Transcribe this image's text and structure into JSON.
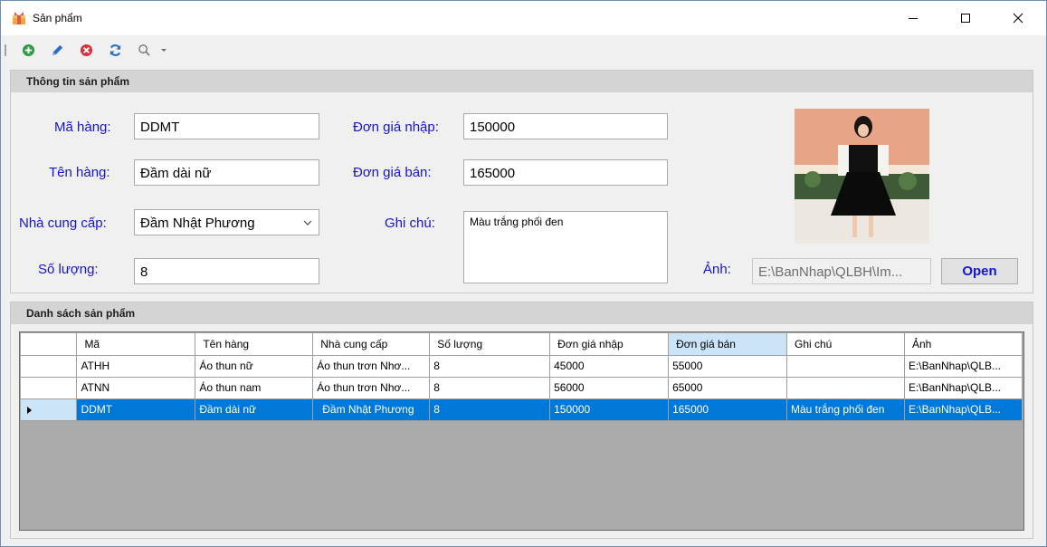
{
  "window": {
    "title": "Sản phẩm",
    "controls": {
      "minimize": "—",
      "maximize": "☐",
      "close": "✕"
    }
  },
  "toolbar": {
    "icons": [
      "add-icon",
      "edit-icon",
      "delete-icon",
      "refresh-icon",
      "search-icon",
      "dropdown-arrow-icon"
    ]
  },
  "info_group": {
    "title": "Thông tin sản phẩm",
    "ma_hang_label": "Mã hàng:",
    "ma_hang_value": "DDMT",
    "ten_hang_label": "Tên hàng:",
    "ten_hang_value": "Đầm dài nữ",
    "nha_cung_cap_label": "Nhà cung cấp:",
    "nha_cung_cap_value": "Đầm Nhật Phương",
    "so_luong_label": "Số lượng:",
    "so_luong_value": "8",
    "don_gia_nhap_label": "Đơn giá nhập:",
    "don_gia_nhap_value": "150000",
    "don_gia_ban_label": "Đơn giá bán:",
    "don_gia_ban_value": "165000",
    "ghi_chu_label": "Ghi chú:",
    "ghi_chu_value": "Màu trắng phối đen",
    "anh_label": "Ảnh:",
    "anh_value": "E:\\BanNhap\\QLBH\\Im...",
    "open_label": "Open"
  },
  "list_group": {
    "title": "Danh sách sản phẩm",
    "columns": [
      "Mã",
      "Tên hàng",
      "Nhà cung cấp",
      "Số lượng",
      "Đơn giá nhập",
      "Đơn giá bán",
      "Ghi chú",
      "Ảnh"
    ],
    "rows": [
      [
        "ATHH",
        "Áo thun nữ",
        "Áo thun trơn Nhơ...",
        "8",
        "45000",
        "55000",
        "",
        "E:\\BanNhap\\QLB..."
      ],
      [
        "ATNN",
        "Áo thun nam",
        "Áo thun trơn Nhơ...",
        "8",
        "56000",
        "65000",
        "",
        "E:\\BanNhap\\QLB..."
      ],
      [
        "DDMT",
        "Đầm dài nữ",
        "Đầm Nhật Phương",
        "8",
        "150000",
        "165000",
        "Màu trắng phối đen",
        "E:\\BanNhap\\QLB..."
      ]
    ],
    "selected_row": 2
  },
  "colors": {
    "label_blue": "#1414d2",
    "selection_blue": "#0078d7",
    "sorted_header": "#cce4f7"
  }
}
